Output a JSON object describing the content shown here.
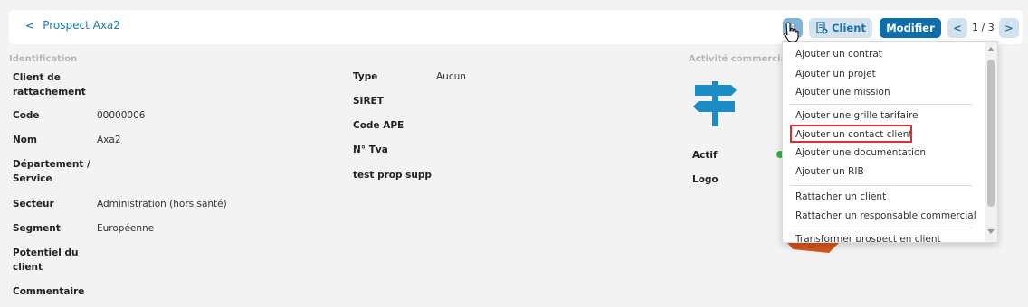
{
  "header": {
    "back_label": "Prospect Axa2",
    "client_button": "Client",
    "modifier_button": "Modifier",
    "pager": "1 / 3",
    "kebab": "⋮"
  },
  "identification": {
    "section_title": "Identification",
    "fields": [
      {
        "label_line1": "Client de",
        "label_line2": "rattachement",
        "value": ""
      },
      {
        "label": "Code",
        "value": "00000006"
      },
      {
        "label": "Nom",
        "value": "Axa2"
      },
      {
        "label_line1": "Département /",
        "label_line2": "Service",
        "value": ""
      },
      {
        "label": "Secteur",
        "value": "Administration (hors santé)"
      },
      {
        "label": "Segment",
        "value": "Européenne"
      },
      {
        "label_line1": "Potentiel du",
        "label_line2": "client",
        "value": ""
      },
      {
        "label": "Commentaire",
        "value": ""
      }
    ]
  },
  "middle": {
    "fields": [
      {
        "label": "Type",
        "value": "Aucun"
      },
      {
        "label": "SIRET",
        "value": ""
      },
      {
        "label": "Code APE",
        "value": ""
      },
      {
        "label": "N° Tva",
        "value": ""
      },
      {
        "label": "test prop supp",
        "value": ""
      }
    ]
  },
  "commercial": {
    "section_title": "Activité commerciale",
    "actif_label": "Actif",
    "logo_label": "Logo",
    "status_color": "#2fae3b"
  },
  "dropdown": {
    "items": [
      "Ajouter un contrat",
      "Ajouter un projet",
      "Ajouter une mission",
      "Ajouter une grille tarifaire",
      "Ajouter un contact client",
      "Ajouter une documentation",
      "Ajouter un RIB",
      "Rattacher un client",
      "Rattacher un responsable commercial",
      "Transformer prospect en client"
    ],
    "highlighted": "Ajouter un contact client",
    "highlight_color": "#d83030"
  },
  "colors": {
    "accent": "#1a7bb3",
    "primary_button": "#0e6ea9",
    "light_button": "#d2e3ef",
    "signpost": "#1b8cc4"
  }
}
